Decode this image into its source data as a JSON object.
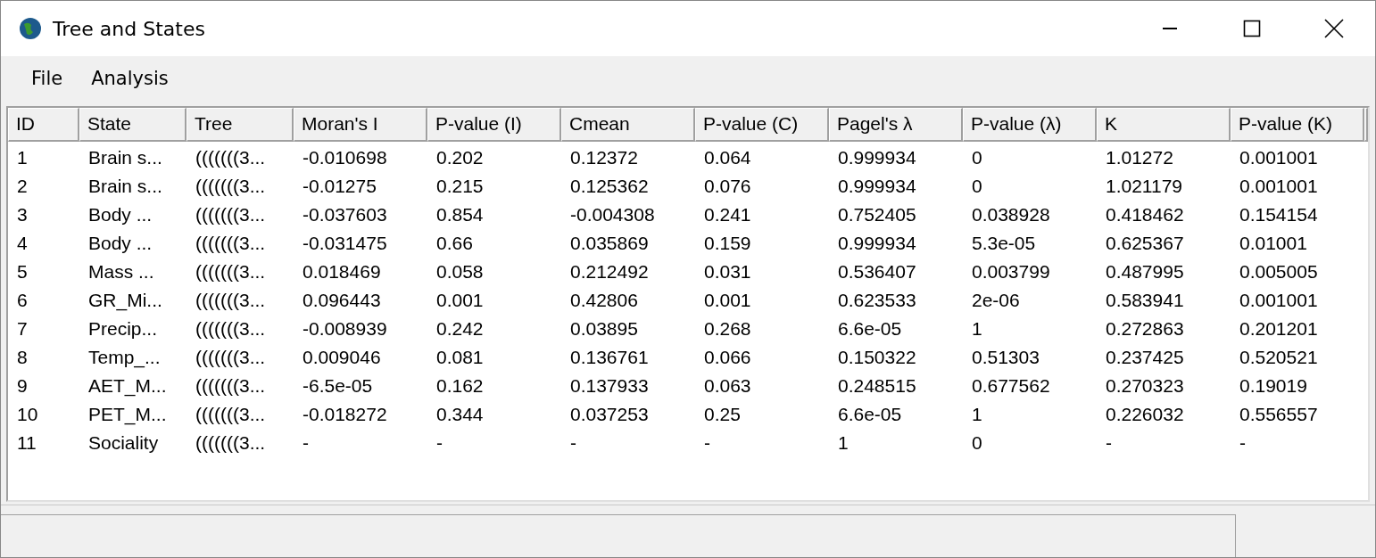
{
  "window": {
    "title": "Tree and States"
  },
  "menu": [
    "File",
    "Analysis"
  ],
  "table": {
    "columns": [
      "ID",
      "State",
      "Tree",
      "Moran's I",
      "P-value (I)",
      "Cmean",
      "P-value (C)",
      "Pagel's λ",
      "P-value (λ)",
      "K",
      "P-value (K)"
    ],
    "rows": [
      [
        "1",
        "Brain s...",
        "(((((((3...",
        "-0.010698",
        "0.202",
        "0.12372",
        "0.064",
        "0.999934",
        "0",
        "1.01272",
        "0.001001"
      ],
      [
        "2",
        "Brain s...",
        "(((((((3...",
        "-0.01275",
        "0.215",
        "0.125362",
        "0.076",
        "0.999934",
        "0",
        "1.021179",
        "0.001001"
      ],
      [
        "3",
        "Body ...",
        "(((((((3...",
        "-0.037603",
        "0.854",
        "-0.004308",
        "0.241",
        "0.752405",
        "0.038928",
        "0.418462",
        "0.154154"
      ],
      [
        "4",
        "Body ...",
        "(((((((3...",
        "-0.031475",
        "0.66",
        "0.035869",
        "0.159",
        "0.999934",
        "5.3e-05",
        "0.625367",
        "0.01001"
      ],
      [
        "5",
        "Mass ...",
        "(((((((3...",
        "0.018469",
        "0.058",
        "0.212492",
        "0.031",
        "0.536407",
        "0.003799",
        "0.487995",
        "0.005005"
      ],
      [
        "6",
        "GR_Mi...",
        "(((((((3...",
        "0.096443",
        "0.001",
        "0.42806",
        "0.001",
        "0.623533",
        "2e-06",
        "0.583941",
        "0.001001"
      ],
      [
        "7",
        "Precip...",
        "(((((((3...",
        "-0.008939",
        "0.242",
        "0.03895",
        "0.268",
        "6.6e-05",
        "1",
        "0.272863",
        "0.201201"
      ],
      [
        "8",
        "Temp_...",
        "(((((((3...",
        "0.009046",
        "0.081",
        "0.136761",
        "0.066",
        "0.150322",
        "0.51303",
        "0.237425",
        "0.520521"
      ],
      [
        "9",
        "AET_M...",
        "(((((((3...",
        "-6.5e-05",
        "0.162",
        "0.137933",
        "0.063",
        "0.248515",
        "0.677562",
        "0.270323",
        "0.19019"
      ],
      [
        "10",
        "PET_M...",
        "(((((((3...",
        "-0.018272",
        "0.344",
        "0.037253",
        "0.25",
        "6.6e-05",
        "1",
        "0.226032",
        "0.556557"
      ],
      [
        "11",
        "Sociality",
        "(((((((3...",
        "-",
        "-",
        "-",
        "-",
        "1",
        "0",
        "-",
        "-"
      ]
    ]
  }
}
